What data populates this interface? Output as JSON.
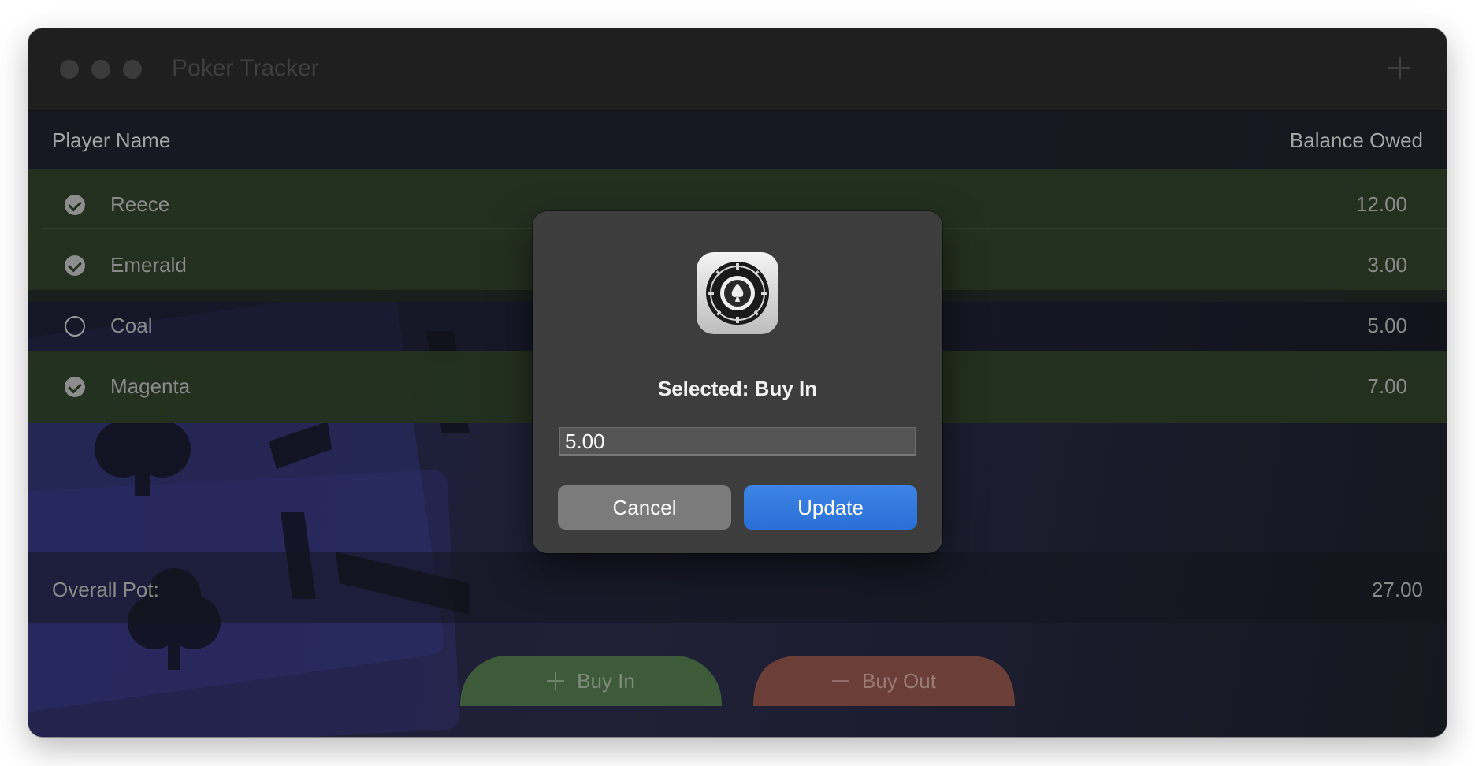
{
  "window": {
    "title": "Poker Tracker"
  },
  "table": {
    "headers": {
      "name": "Player Name",
      "balance": "Balance Owed"
    },
    "rows": [
      {
        "name": "Reece",
        "balance": "12.00",
        "selected": true
      },
      {
        "name": "Emerald",
        "balance": "3.00",
        "selected": true
      },
      {
        "name": "Coal",
        "balance": "5.00",
        "selected": false
      },
      {
        "name": "Magenta",
        "balance": "7.00",
        "selected": true
      }
    ]
  },
  "pot": {
    "label": "Overall Pot:",
    "value": "27.00"
  },
  "actions": {
    "buy_in": "Buy In",
    "buy_out": "Buy Out"
  },
  "dialog": {
    "title": "Selected: Buy In",
    "input_value": "5.00",
    "cancel": "Cancel",
    "update": "Update"
  },
  "colors": {
    "selected_row": "#24321f",
    "buy_in": "#3d5a39",
    "buy_out": "#6c3e38",
    "accent": "#2a6fd6"
  },
  "icons": [
    "plus-icon",
    "checkmark-icon",
    "poker-chip-icon",
    "minus-icon"
  ]
}
